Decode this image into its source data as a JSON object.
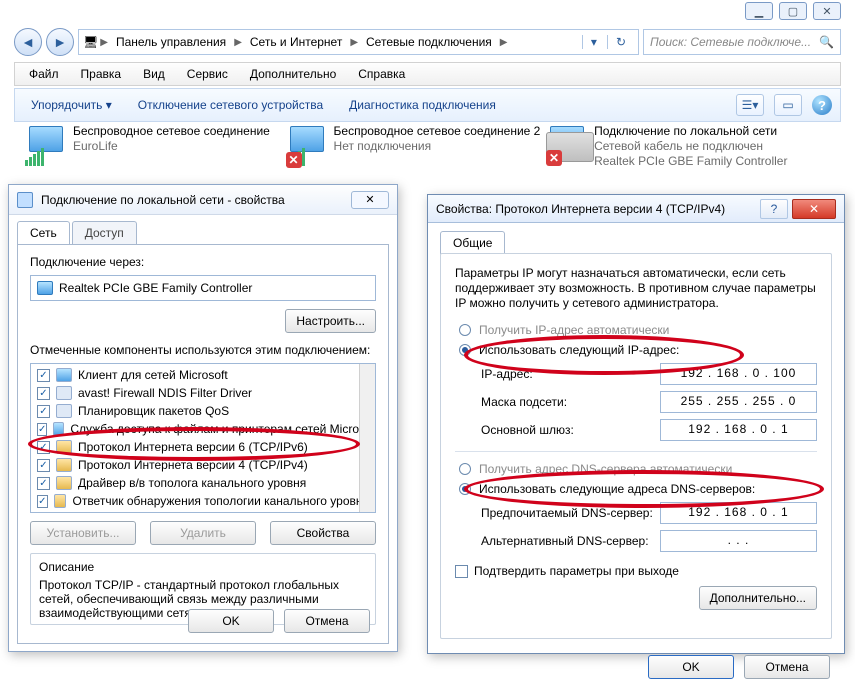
{
  "window": {
    "min": "▁",
    "max": "▢",
    "close": "✕"
  },
  "breadcrumb": {
    "root_icon": "computer-icon",
    "items": [
      "Панель управления",
      "Сеть и Интернет",
      "Сетевые подключения"
    ],
    "search_placeholder": "Поиск: Сетевые подключе...",
    "refresh": "↻",
    "dropdown": "▾"
  },
  "menubar": [
    "Файл",
    "Правка",
    "Вид",
    "Сервис",
    "Дополнительно",
    "Справка"
  ],
  "toolbar": {
    "organize": "Упорядочить ▾",
    "disable": "Отключение сетевого устройства",
    "diagnose": "Диагностика подключения",
    "view_icon": "☰▾",
    "roll_icon": "▭",
    "help": "?"
  },
  "connections": [
    {
      "name": "Беспроводное сетевое соединение",
      "status": "EuroLife",
      "state": "wifi"
    },
    {
      "name": "Беспроводное сетевое соединение 2",
      "status": "Нет подключения",
      "state": "wifi-x"
    },
    {
      "name": "Подключение по локальной сети",
      "status": "Сетевой кабель не подключен",
      "detail": "Realtek PCIe GBE Family Controller",
      "state": "lan-x"
    }
  ],
  "dlg1": {
    "title": "Подключение по локальной сети - свойства",
    "close": "✕",
    "tabs": [
      "Сеть",
      "Доступ"
    ],
    "connect_label": "Подключение через:",
    "adapter": "Realtek PCIe GBE Family Controller",
    "configure_btn": "Настроить...",
    "components_label": "Отмеченные компоненты используются этим подключением:",
    "components": [
      {
        "checked": true,
        "label": "Клиент для сетей Microsoft",
        "icon": "net"
      },
      {
        "checked": true,
        "label": "avast! Firewall NDIS Filter Driver",
        "icon": "plain"
      },
      {
        "checked": true,
        "label": "Планировщик пакетов QoS",
        "icon": "plain"
      },
      {
        "checked": true,
        "label": "Служба доступа к файлам и принтерам сетей Micro...",
        "icon": "net"
      },
      {
        "checked": true,
        "label": "Протокол Интернета версии 6 (TCP/IPv6)",
        "icon": "chain"
      },
      {
        "checked": true,
        "label": "Протокол Интернета версии 4 (TCP/IPv4)",
        "icon": "chain"
      },
      {
        "checked": true,
        "label": "Драйвер в/в тополога канального уровня",
        "icon": "chain"
      },
      {
        "checked": true,
        "label": "Ответчик обнаружения топологии канального уровня",
        "icon": "chain"
      }
    ],
    "install_btn": "Установить...",
    "remove_btn": "Удалить",
    "props_btn": "Свойства",
    "desc_heading": "Описание",
    "desc_text": "Протокол TCP/IP - стандартный протокол глобальных сетей, обеспечивающий связь между различными взаимодействующими сетями.",
    "ok": "OK",
    "cancel": "Отмена"
  },
  "dlg2": {
    "title": "Свойства: Протокол Интернета версии 4 (TCP/IPv4)",
    "help": "?",
    "close": "✕",
    "tab": "Общие",
    "info": "Параметры IP могут назначаться автоматически, если сеть поддерживает эту возможность. В противном случае параметры IP можно получить у сетевого администратора.",
    "r_auto_ip": "Получить IP-адрес автоматически",
    "r_manual_ip": "Использовать следующий IP-адрес:",
    "f_ip": "IP-адрес:",
    "v_ip": "192 . 168 .  0  . 100",
    "f_mask": "Маска подсети:",
    "v_mask": "255 . 255 . 255 .  0",
    "f_gw": "Основной шлюз:",
    "v_gw": "192 . 168 .  0  .  1",
    "r_auto_dns": "Получить адрес DNS-сервера автоматически",
    "r_manual_dns": "Использовать следующие адреса DNS-серверов:",
    "f_dns1": "Предпочитаемый DNS-сервер:",
    "v_dns1": "192 . 168 .  0  .  1",
    "f_dns2": "Альтернативный DNS-сервер:",
    "v_dns2": " .       .       .",
    "confirm": "Подтвердить параметры при выходе",
    "advanced": "Дополнительно...",
    "ok": "OK",
    "cancel": "Отмена"
  }
}
